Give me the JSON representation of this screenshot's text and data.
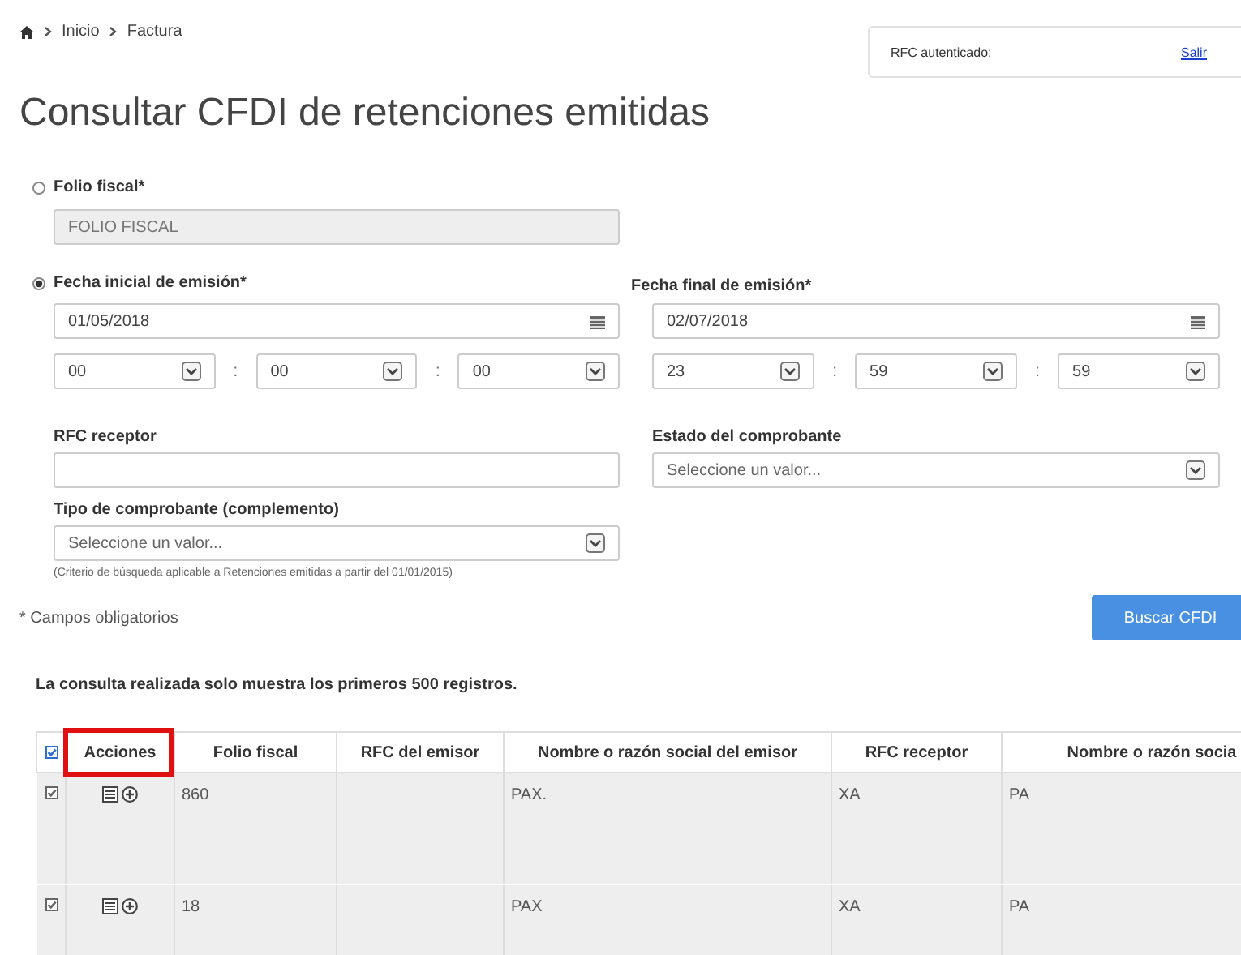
{
  "breadcrumb": [
    "Inicio",
    "Factura"
  ],
  "auth": {
    "label": "RFC autenticado:",
    "logout": "Salir"
  },
  "title": "Consultar CFDI de retenciones emitidas",
  "folio": {
    "label": "Folio fiscal*",
    "selected": false,
    "placeholder": "FOLIO FISCAL",
    "disabled": true
  },
  "fecha_inicial": {
    "label": "Fecha inicial de emisión*",
    "selected": true,
    "date": "01/05/2018",
    "time": [
      "00",
      "00",
      "00"
    ],
    "separators": [
      ":",
      ":"
    ]
  },
  "fecha_final": {
    "label": "Fecha final de emisión*",
    "date": "02/07/2018",
    "time": [
      "23",
      "59",
      "59"
    ],
    "separators": [
      ":",
      ":"
    ]
  },
  "rfc_receptor": {
    "label": "RFC receptor"
  },
  "estado": {
    "label": "Estado del comprobante",
    "placeholder": "Seleccione un valor..."
  },
  "tipo": {
    "label": "Tipo de comprobante (complemento)",
    "placeholder": "Seleccione un valor...",
    "note": "(Criterio de búsqueda aplicable a Retenciones emitidas a partir del 01/01/2015)"
  },
  "required_note": "* Campos obligatorios",
  "search_button": "Buscar CFDI",
  "limit_note": "La consulta realizada solo muestra los primeros 500 registros.",
  "table": {
    "select_all": {
      "checked": true
    },
    "columns": [
      {
        "label": "Acciones",
        "highlighted": true
      },
      {
        "label": "Folio fiscal",
        "highlighted": false
      },
      {
        "label": "RFC del emisor",
        "highlighted": false
      },
      {
        "label": "Nombre o razón social del emisor",
        "highlighted": false
      },
      {
        "label": "RFC receptor",
        "highlighted": false
      },
      {
        "label": "Nombre o razón socia",
        "highlighted": false
      }
    ],
    "rows": [
      {
        "checked": true,
        "folio_fiscal": "860",
        "nombre_emisor": "PAX.",
        "rfc_receptor": "XA",
        "nombre_receptor": "PA"
      },
      {
        "checked": true,
        "folio_fiscal": "18",
        "nombre_emisor": "PAX",
        "rfc_receptor": "XA",
        "nombre_receptor": "PA"
      }
    ]
  }
}
